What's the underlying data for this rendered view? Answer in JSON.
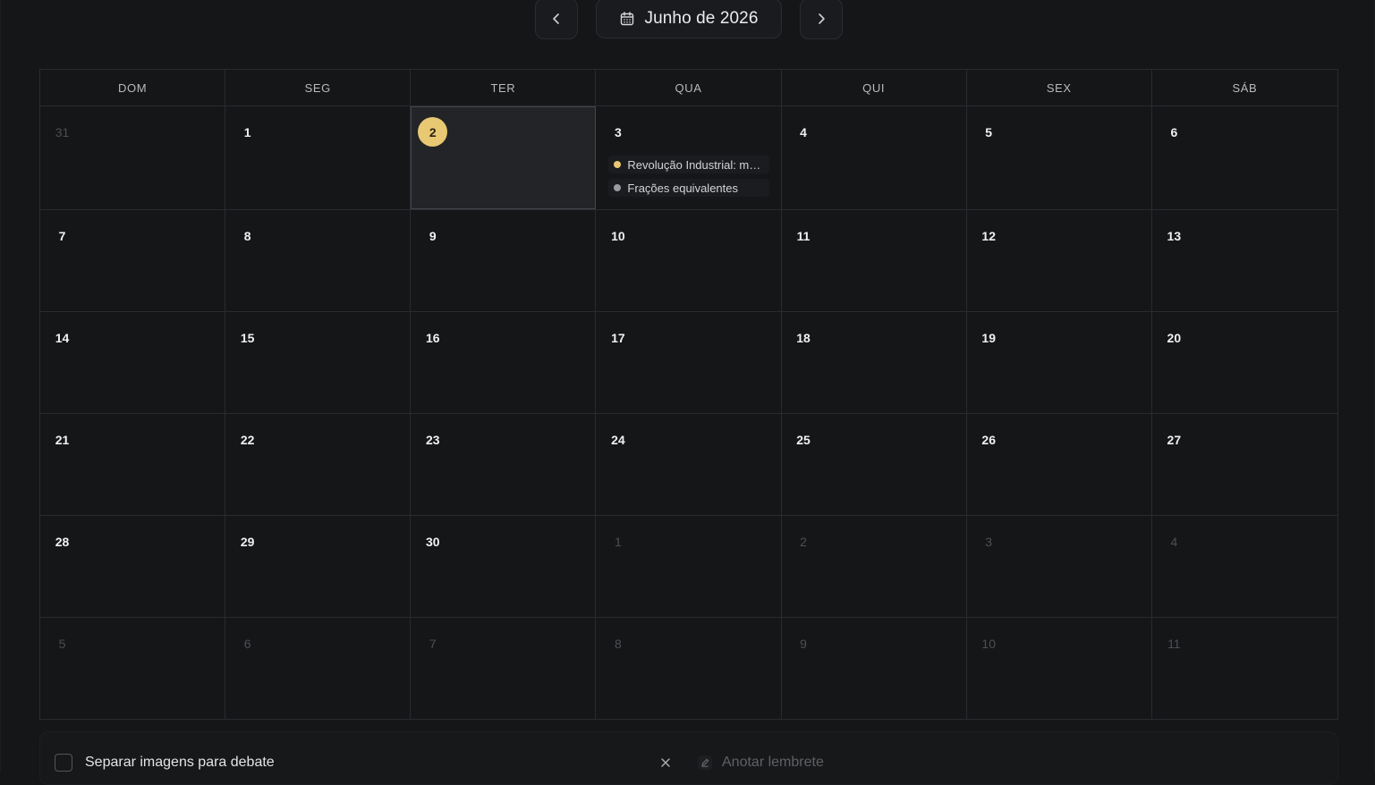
{
  "header": {
    "month_label": "Junho de 2026",
    "prev_icon": "chevron-left-icon",
    "next_icon": "chevron-right-icon",
    "calendar_icon": "calendar-icon"
  },
  "weekdays": [
    "DOM",
    "SEG",
    "TER",
    "QUA",
    "QUI",
    "SEX",
    "SÁB"
  ],
  "weeks": [
    [
      {
        "day": "31",
        "muted": true
      },
      {
        "day": "1"
      },
      {
        "day": "2",
        "today": true
      },
      {
        "day": "3",
        "events": [
          {
            "title": "Revolução Industrial: m…",
            "color": "#e8c872"
          },
          {
            "title": "Frações equivalentes",
            "color": "#9a9ba0"
          }
        ]
      },
      {
        "day": "4"
      },
      {
        "day": "5"
      },
      {
        "day": "6"
      }
    ],
    [
      {
        "day": "7"
      },
      {
        "day": "8"
      },
      {
        "day": "9"
      },
      {
        "day": "10"
      },
      {
        "day": "11"
      },
      {
        "day": "12"
      },
      {
        "day": "13"
      }
    ],
    [
      {
        "day": "14"
      },
      {
        "day": "15"
      },
      {
        "day": "16"
      },
      {
        "day": "17"
      },
      {
        "day": "18"
      },
      {
        "day": "19"
      },
      {
        "day": "20"
      }
    ],
    [
      {
        "day": "21"
      },
      {
        "day": "22"
      },
      {
        "day": "23"
      },
      {
        "day": "24"
      },
      {
        "day": "25"
      },
      {
        "day": "26"
      },
      {
        "day": "27"
      }
    ],
    [
      {
        "day": "28"
      },
      {
        "day": "29"
      },
      {
        "day": "30"
      },
      {
        "day": "1",
        "muted": true
      },
      {
        "day": "2",
        "muted": true
      },
      {
        "day": "3",
        "muted": true
      },
      {
        "day": "4",
        "muted": true
      }
    ],
    [
      {
        "day": "5",
        "muted": true
      },
      {
        "day": "6",
        "muted": true
      },
      {
        "day": "7",
        "muted": true
      },
      {
        "day": "8",
        "muted": true
      },
      {
        "day": "9",
        "muted": true
      },
      {
        "day": "10",
        "muted": true
      },
      {
        "day": "11",
        "muted": true
      }
    ]
  ],
  "task": {
    "checked": false,
    "label": "Separar imagens para debate",
    "remove_icon": "close-icon",
    "note_icon": "pencil-icon",
    "note_placeholder": "Anotar lembrete",
    "note_value": ""
  },
  "colors": {
    "accent": "#e8c872",
    "background": "#151618",
    "border": "#2a2b2f"
  }
}
